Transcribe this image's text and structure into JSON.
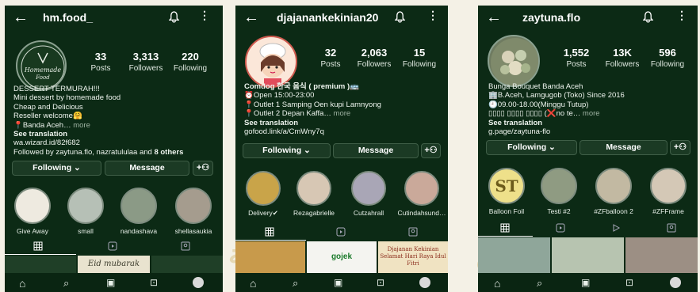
{
  "phones": [
    {
      "username": "hm.food_",
      "avatar_text": "Homemade Food",
      "stats": [
        {
          "n": "33",
          "l": "Posts"
        },
        {
          "n": "3,313",
          "l": "Followers"
        },
        {
          "n": "220",
          "l": "Following"
        }
      ],
      "bio": [
        "DESSERT TERMURAH!!!",
        "Mini dessert by homemade food",
        "Cheap and Delicious",
        "Reseller welcome🤗",
        "📍Banda Aceh…"
      ],
      "more": "more",
      "see_translation": "See translation",
      "link": "wa.wizard.id/82f682",
      "followed_by": "Followed by zaytuna.flo, nazratululaa and ",
      "followed_others": "8 others",
      "following_btn": "Following ⌄",
      "message_btn": "Message",
      "highlights": [
        "Give Away",
        "small",
        "nandashava",
        "shellasaukia"
      ],
      "strip_text": "Eid mubarak"
    },
    {
      "username": "djajanankekinian20",
      "stats": [
        {
          "n": "32",
          "l": "Posts"
        },
        {
          "n": "2,063",
          "l": "Followers"
        },
        {
          "n": "15",
          "l": "Following"
        }
      ],
      "bio_name": "Comdog 한국 음식 ( premium )🚌",
      "bio": [
        "⏰Open 15:00-23:00",
        "📍Outlet 1 Samping Oen kupi Lamnyong",
        "📍Outlet 2 Depan Kaffa…"
      ],
      "more": "more",
      "see_translation": "See translation",
      "link": "gofood.link/a/CmWny7q",
      "following_btn": "Following ⌄",
      "message_btn": "Message",
      "highlights": [
        "Delivery✔",
        "Rezagabrielle",
        "Cutzahrall",
        "Cutindahsund…"
      ],
      "strip_texts": [
        "gojek",
        "Djajanan Kekinian",
        "Selamat Hari Raya Idul Fitri"
      ]
    },
    {
      "username": "zaytuna.flo",
      "stats": [
        {
          "n": "1,552",
          "l": "Posts"
        },
        {
          "n": "13K",
          "l": "Followers"
        },
        {
          "n": "596",
          "l": "Following"
        }
      ],
      "bio_name": "Bunga Bouquet Banda Aceh",
      "bio": [
        "🏢B.Aceh, Lamgugob (Toko) Since 2016",
        "🕘09.00-18.00(Minggu Tutup)",
        "▯▯▯▯ ▯▯▯▯ ▯▯▯▯ (❌no te…"
      ],
      "more": "more",
      "see_translation": "See translation",
      "link": "g.page/zaytuna-flo",
      "following_btn": "Following ⌄",
      "message_btn": "Message",
      "highlights": [
        "Balloon Foil",
        "Testi #2",
        "#ZFballoon 2",
        "#ZFFrame"
      ]
    }
  ],
  "colors": {
    "bg": "#0c2a15",
    "button": "#1b3a24",
    "accent": "#f2e27a"
  }
}
